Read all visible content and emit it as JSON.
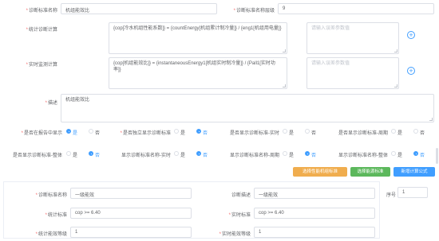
{
  "form": {
    "name_label": "诊断标准名称",
    "name_value": "机组能效比",
    "level_label": "诊断标准名称层级",
    "level_value": "9",
    "stat_calc_label": "统计诊断计算",
    "stat_calc_value": "{cop[冷水机组性能系数]} = {countEnergy[机组累计制冷量]} / {eng1[机组用电量]}",
    "stat_calc_placeholder": "请输入误差参数值",
    "realtime_calc_label": "实时监测计算",
    "realtime_calc_value": "{cop[机组能效比]} = {instantaneousEnergy1[机组实时制冷量]} / {Pall1[实时功率]}",
    "realtime_calc_placeholder": "请输入误差参数值",
    "desc_label": "描述",
    "desc_value": "机组能效比",
    "plus_icon": "+"
  },
  "radios": {
    "yes": "是",
    "no": "否",
    "rows": [
      [
        {
          "label": "是否在报告中显示",
          "required": true,
          "selected": "yes"
        },
        {
          "label": "是否独立显示诊断标准",
          "required": true,
          "selected": "no"
        },
        {
          "label": "是否显示诊断标准-实时",
          "required": false,
          "selected": "no"
        },
        {
          "label": "是否显示诊断标准-周期",
          "required": false,
          "selected": "no"
        }
      ],
      [
        {
          "label": "是否显示诊断标准-整体",
          "required": false,
          "selected": "no"
        },
        {
          "label": "显示诊断标准名称-实时",
          "required": false,
          "selected": "no"
        },
        {
          "label": "显示诊断标准名称-周期",
          "required": false,
          "selected": "no"
        },
        {
          "label": "显示诊断标准名称-整体",
          "required": false,
          "selected": "no"
        }
      ]
    ]
  },
  "buttons": {
    "select_perf": "选择性能机组标准",
    "select_energy": "选择能源标准",
    "add_calc": "新增计算公式"
  },
  "colors": {
    "orange": "#f0ad4e",
    "green": "#5cb85c",
    "blue": "#409eff",
    "required": "#f56c6c"
  },
  "sub": {
    "name_label": "诊断标准名称",
    "name_value": "一级能效",
    "desc_label": "诊断描述",
    "desc_value": "一级能效",
    "stat_label": "统计标准",
    "stat_value": "cop >= 6.40",
    "real_label": "实时标准",
    "real_value": "cop >= 6.40",
    "stat_level_label": "统计能效等级",
    "stat_level_value": "1",
    "real_level_label": "实时能效等级",
    "real_level_value": "1",
    "seq_label": "序号",
    "seq_value": "1"
  }
}
